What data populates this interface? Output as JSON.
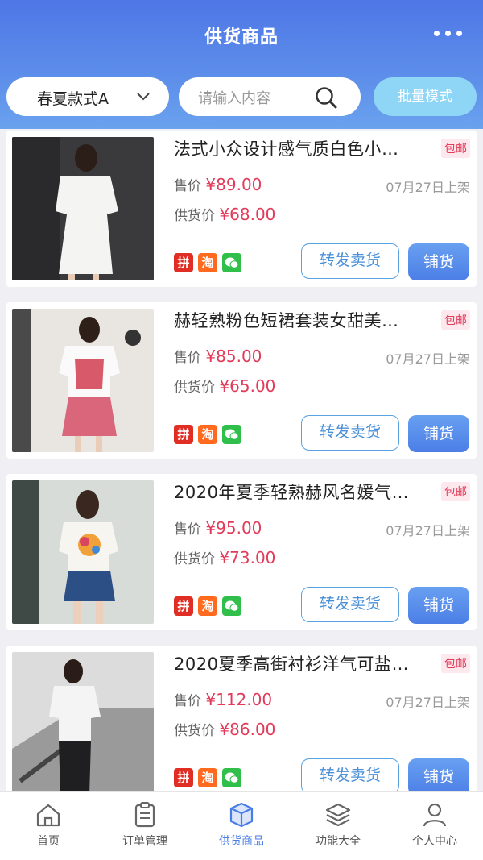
{
  "header": {
    "title": "供货商品"
  },
  "filters": {
    "season": "春夏款式A",
    "search_placeholder": "请输入内容",
    "batch_label": "批量模式"
  },
  "labels": {
    "sale": "售价",
    "supply": "供货价",
    "currency": "¥",
    "forward": "转发卖货",
    "stock": "铺货"
  },
  "products": [
    {
      "name": "法式小众设计感气质白色小…",
      "ship_tag": "包邮",
      "sale_price": "89.00",
      "supply_price": "68.00",
      "date": "07月27日上架"
    },
    {
      "name": "赫轻熟粉色短裙套装女甜美…",
      "ship_tag": "包邮",
      "sale_price": "85.00",
      "supply_price": "65.00",
      "date": "07月27日上架"
    },
    {
      "name": "2020年夏季轻熟赫风名媛气…",
      "ship_tag": "包邮",
      "sale_price": "95.00",
      "supply_price": "73.00",
      "date": "07月27日上架"
    },
    {
      "name": "2020夏季高街衬衫洋气可盐…",
      "ship_tag": "包邮",
      "sale_price": "112.00",
      "supply_price": "86.00",
      "date": "07月27日上架"
    }
  ],
  "badges": {
    "pdd": "拼",
    "taobao": "淘"
  },
  "tabs": [
    {
      "label": "首页",
      "icon": "home-icon"
    },
    {
      "label": "订单管理",
      "icon": "clipboard-icon"
    },
    {
      "label": "供货商品",
      "icon": "box-icon",
      "active": true
    },
    {
      "label": "功能大全",
      "icon": "layers-icon"
    },
    {
      "label": "个人中心",
      "icon": "user-icon"
    }
  ],
  "colors": {
    "accent": "#4e77e6",
    "price": "#e23b5a",
    "batch": "#8fd6f6"
  }
}
